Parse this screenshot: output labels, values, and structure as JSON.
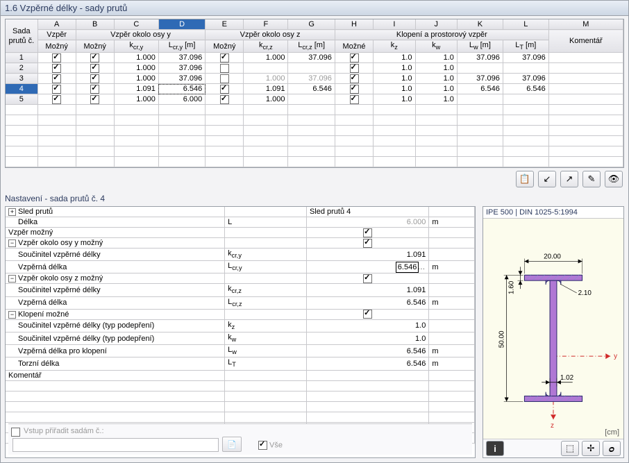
{
  "title": "1.6 Vzpěrné délky - sady prutů",
  "cols": [
    "A",
    "B",
    "C",
    "D",
    "E",
    "F",
    "G",
    "H",
    "I",
    "J",
    "K",
    "L",
    "M"
  ],
  "hdr": {
    "r0": "Sada",
    "r1": "prutů č.",
    "a0": "Vzpěr",
    "a1": "Možný",
    "by": "Vzpěr okolo osy y",
    "b1": "Možný",
    "c1": "kcr,y",
    "d1": "Lcr,y [m]",
    "bz": "Vzpěr okolo osy z",
    "e1": "Možný",
    "f1": "kcr,z",
    "g1": "Lcr,z [m]",
    "lt": "Klopení a prostorový vzpěr",
    "h1": "Možné",
    "i1": "kz",
    "j1": "kw",
    "k1": "Lw [m]",
    "l1": "LT [m]",
    "m": "Komentář"
  },
  "rows": [
    {
      "n": "1",
      "a": true,
      "b": true,
      "c": "1.000",
      "d": "37.096",
      "e": true,
      "f": "1.000",
      "g": "37.096",
      "h": true,
      "i": "1.0",
      "j": "1.0",
      "k": "37.096",
      "l": "37.096"
    },
    {
      "n": "2",
      "a": true,
      "b": true,
      "c": "1.000",
      "d": "37.096",
      "e": false,
      "f": "",
      "g": "",
      "h": true,
      "i": "1.0",
      "j": "1.0",
      "k": "",
      "l": ""
    },
    {
      "n": "3",
      "a": true,
      "b": true,
      "c": "1.000",
      "d": "37.096",
      "e": false,
      "f": "1.000",
      "g": "37.096",
      "grey": true,
      "h": true,
      "i": "1.0",
      "j": "1.0",
      "k": "37.096",
      "l": "37.096"
    },
    {
      "n": "4",
      "a": true,
      "b": true,
      "c": "1.091",
      "d": "6.546",
      "dDot": true,
      "e": true,
      "f": "1.091",
      "g": "6.546",
      "h": true,
      "i": "1.0",
      "j": "1.0",
      "k": "6.546",
      "l": "6.546",
      "sel": true
    },
    {
      "n": "5",
      "a": true,
      "b": true,
      "c": "1.000",
      "d": "6.000",
      "e": true,
      "f": "1.000",
      "g": "",
      "h": true,
      "i": "1.0",
      "j": "1.0",
      "k": "",
      "l": ""
    }
  ],
  "toolbar_icons": [
    "📋",
    "↙",
    "↗",
    "✎",
    "👁"
  ],
  "bottom_title": "Nastavení - sada prutů č. 4",
  "props": [
    {
      "tree": "+",
      "lbl": "Sled prutů",
      "sym": "",
      "val": "Sled prutů 4",
      "valAlign": "left",
      "unit": ""
    },
    {
      "indent": 1,
      "lbl": "Délka",
      "sym": "L",
      "val": "6.000",
      "grey": true,
      "unit": "m"
    },
    {
      "indent": 0,
      "lbl": "Vzpěr možný",
      "sym": "",
      "val": "chk",
      "unit": ""
    },
    {
      "tree": "-",
      "lbl": "Vzpěr okolo osy y možný",
      "sym": "",
      "val": "chk",
      "unit": ""
    },
    {
      "indent": 1,
      "lbl": "Součinitel vzpěrné délky",
      "sym": "kcr,y",
      "val": "1.091",
      "unit": ""
    },
    {
      "indent": 1,
      "lbl": "Vzpěrná délka",
      "sym": "Lcr,y",
      "val": "6.546",
      "selInput": true,
      "unit": "m"
    },
    {
      "tree": "-",
      "lbl": "Vzpěr okolo osy z možný",
      "sym": "",
      "val": "chk",
      "unit": ""
    },
    {
      "indent": 1,
      "lbl": "Součinitel vzpěrné délky",
      "sym": "kcr,z",
      "val": "1.091",
      "unit": ""
    },
    {
      "indent": 1,
      "lbl": "Vzpěrná délka",
      "sym": "Lcr,z",
      "val": "6.546",
      "unit": "m"
    },
    {
      "tree": "-",
      "lbl": "Klopení možné",
      "sym": "",
      "val": "chk",
      "unit": ""
    },
    {
      "indent": 1,
      "lbl": "Součinitel vzpěrné délky (typ podepření)",
      "sym": "kz",
      "val": "1.0",
      "unit": ""
    },
    {
      "indent": 1,
      "lbl": "Součinitel vzpěrné délky (typ podepření)",
      "sym": "kw",
      "val": "1.0",
      "unit": ""
    },
    {
      "indent": 1,
      "lbl": "Vzpěrná délka pro klopení",
      "sym": "Lw",
      "val": "6.546",
      "unit": "m"
    },
    {
      "indent": 1,
      "lbl": "Torzní délka",
      "sym": "LT",
      "val": "6.546",
      "unit": "m"
    },
    {
      "indent": 0,
      "lbl": "Komentář",
      "sym": "",
      "val": "",
      "unit": ""
    }
  ],
  "foot": {
    "assign": "Vstup přiřadit sadám č.:",
    "all": "Vše"
  },
  "preview": {
    "title": "IPE 500 | DIN 1025-5:1994",
    "unit": "[cm]",
    "dims": {
      "w": "20.00",
      "h": "50.00",
      "tf": "1.60",
      "tw": "1.02",
      "r": "2.10"
    },
    "axes": {
      "y": "y",
      "z": "z"
    }
  }
}
